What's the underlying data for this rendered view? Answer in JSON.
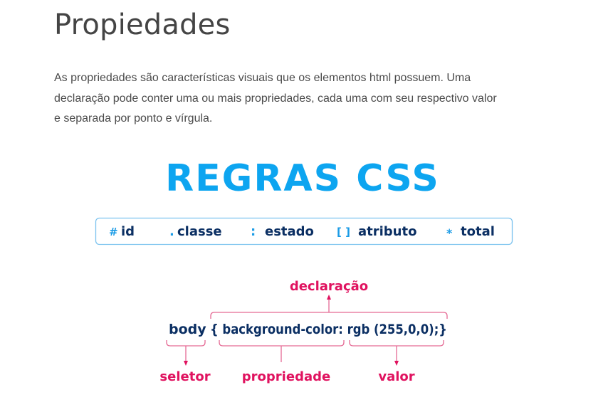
{
  "heading": "Propiedades",
  "paragraph": [
    "As propriedades são características visuais que os elementos html possuem. Uma",
    "declaração pode conter uma ou mais propriedades, cada uma com seu respectivo valor",
    "e separada por ponto e vírgula."
  ],
  "figure": {
    "title": "REGRAS CSS",
    "selectors": [
      {
        "symbol": "#",
        "label": "id"
      },
      {
        "symbol": ".",
        "label": "classe"
      },
      {
        "symbol": ":",
        "label": "estado"
      },
      {
        "symbol": "[ ]",
        "label": "atributo"
      },
      {
        "symbol": "*",
        "label": "total"
      }
    ],
    "code": {
      "selector": "body",
      "declaration": "{ background-color: rgb (255,0,0);}"
    },
    "annotations": {
      "declaration": "declaração",
      "selector": "seletor",
      "property": "propriedade",
      "value": "valor"
    },
    "colors": {
      "title": "#0da5f0",
      "navy": "#0b2f63",
      "symbol": "#1a9be6",
      "annotation": "#e0125f",
      "bracket": "#e56a94",
      "box_border": "#7cc3ef"
    }
  }
}
